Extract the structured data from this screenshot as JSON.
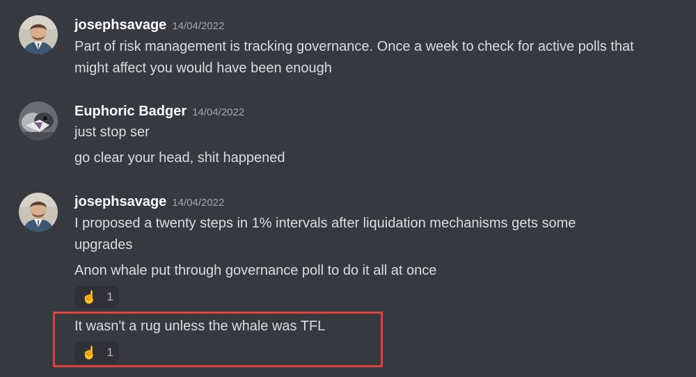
{
  "messages": [
    {
      "username": "josephsavage",
      "timestamp": "14/04/2022",
      "lines": [
        "Part of risk management is tracking governance. Once a week to check for active polls that",
        "might affect you would have been enough"
      ]
    },
    {
      "username": "Euphoric Badger",
      "timestamp": "14/04/2022",
      "lines": [
        "just stop ser",
        "go clear your head, shit happened"
      ]
    },
    {
      "username": "josephsavage",
      "timestamp": "14/04/2022",
      "lines": [
        "I proposed a twenty steps in 1% intervals after liquidation mechanisms gets some",
        "upgrades",
        "Anon whale put through governance poll to do it all at once",
        "It wasn't a rug unless the whale was TFL"
      ],
      "reactions": [
        {
          "emoji": "☝️",
          "emoji_icon": "pointing-up-icon",
          "count": "1"
        },
        {
          "emoji": "☝️",
          "emoji_icon": "pointing-up-icon",
          "count": "1"
        }
      ]
    }
  ],
  "colors": {
    "background": "#36393f",
    "username": "#ffffff",
    "timestamp": "#a3a6aa",
    "text": "#dcddde",
    "reaction_bg": "#2f3136",
    "highlight": "#e0413a"
  }
}
